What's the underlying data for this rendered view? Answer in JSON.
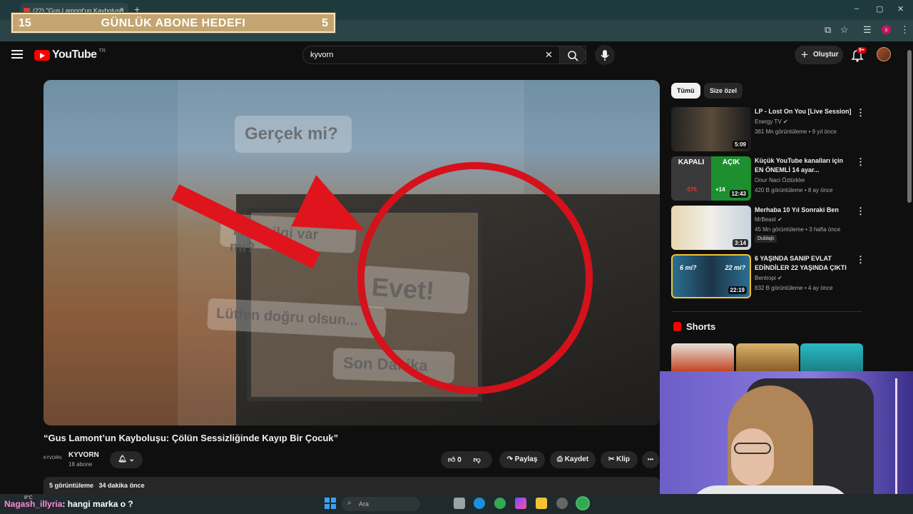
{
  "browser": {
    "tab_title": "(22) \"Gus Lamont'un Kaybolușu",
    "tab_close": "×",
    "new_tab": "+",
    "window_controls": [
      "–",
      "▢",
      "✕"
    ]
  },
  "overlay": {
    "abone_left": "15",
    "abone_title": "GÜNLÜK ABONE HEDEFI",
    "abone_right": "5"
  },
  "header": {
    "logo_text": "YouTube",
    "logo_region": "TR",
    "search_value": "kyvorn",
    "clear_icon": "✕",
    "create_label": "Oluştur",
    "notif_badge": "9+"
  },
  "video": {
    "overlay_texts": [
      "Gerçek mi?",
      "Yeni bilgi var mı?",
      "Evet!",
      "Lütfen doğru olsun...",
      "Son Dakika"
    ],
    "title": "“Gus Lamont’un Kayboluşu: Çölün Sessizliğinde Kayıp Bir Çocuk”",
    "channel_logo_text": "KYVORN",
    "channel_name": "KYVORN",
    "subscribers": "18 abone",
    "likes": "0",
    "share_label": "Paylaş",
    "save_label": "Kaydet",
    "clip_label": "Klip",
    "more_label": "•••",
    "views": "5 görüntüleme",
    "time_ago": "34 dakika önce"
  },
  "sidebar": {
    "chips": [
      "Tümü",
      "Size özel"
    ],
    "recommendations": [
      {
        "title": "LP - Lost On You [Live Session]",
        "channel": "Energy TV",
        "meta": "361 Mn görüntüleme • 9 yıl önce",
        "duration": "5:09"
      },
      {
        "title": "Küçük YouTube kanalları için EN ÖNEMLİ 14 ayar...",
        "channel": "Onur Naci Öztürkler",
        "meta": "420 B görüntüleme • 8 ay önce",
        "duration": "12:43",
        "thumb_left": "KAPALI",
        "thumb_right": "AÇIK",
        "thumb_small_left": "-576",
        "thumb_small_right": "+14"
      },
      {
        "title": "Merhaba 10 Yıl Sonraki Ben",
        "channel": "MrBeast",
        "meta": "45 Mn görüntüleme • 3 hafta önce",
        "extra": "Dublajlı",
        "duration": "3:14"
      },
      {
        "title": "6 YAŞINDA SANIP EVLAT EDİNDİLER 22 YAŞINDA ÇIKTI",
        "channel": "Bentropi",
        "meta": "832 B görüntüleme • 4 ay önce",
        "duration": "22:19",
        "thumb_left": "6 mi?",
        "thumb_right": "22 mi?"
      }
    ],
    "shorts_label": "Shorts"
  },
  "taskbar": {
    "weather": "8°C",
    "search_placeholder": "Ara"
  },
  "chat": {
    "user": "Nagash_illyria",
    "message": ": hangi marka o ?"
  },
  "colors": {
    "yt_red": "#ff0000",
    "arrow_red": "#e0141c",
    "abone_gold": "#c2a570"
  }
}
